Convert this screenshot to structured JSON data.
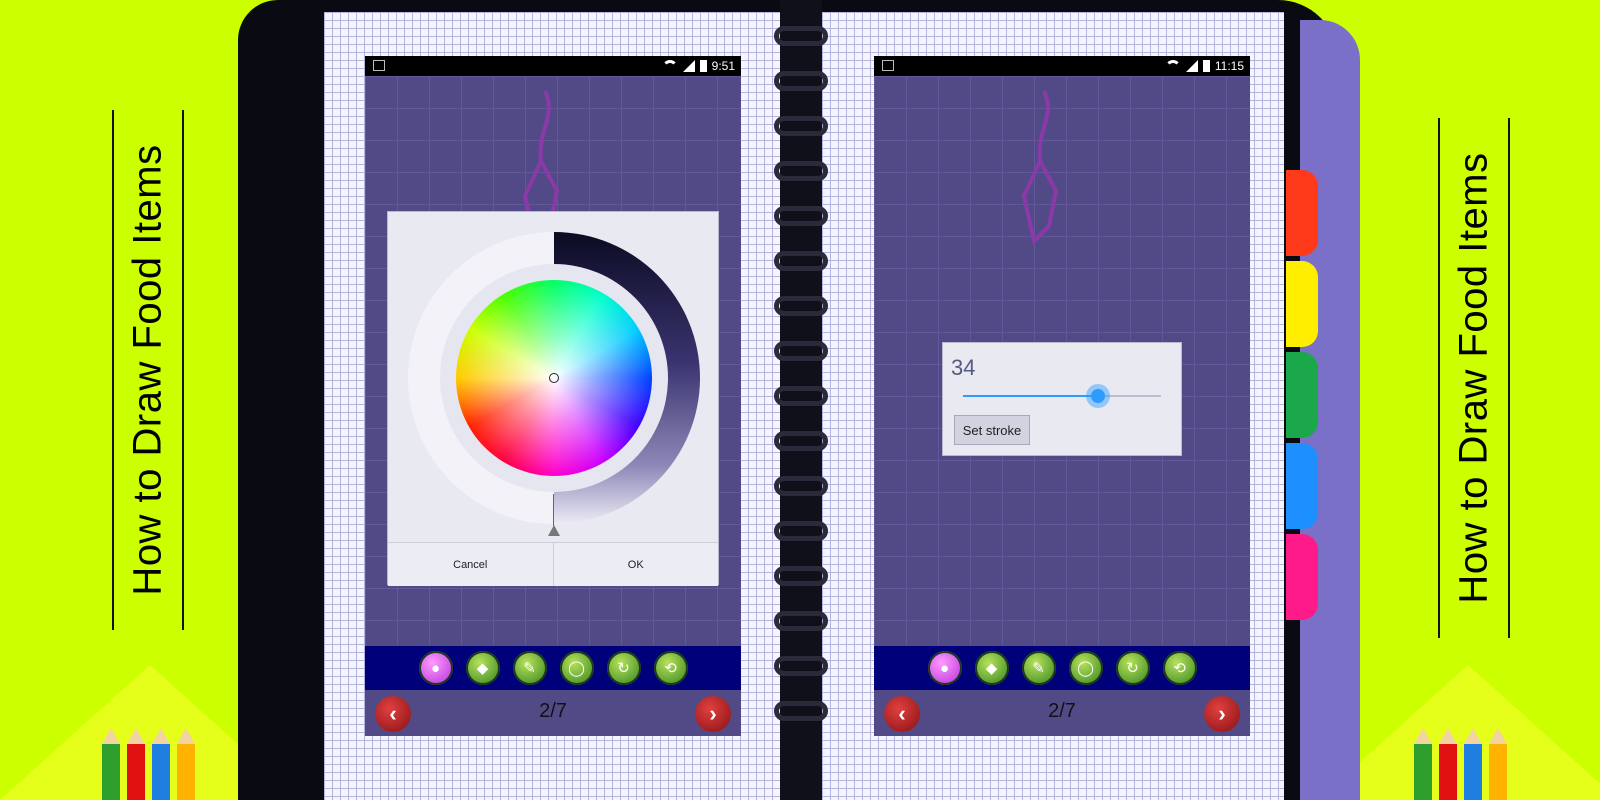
{
  "banner": {
    "title": "How to Draw Food Items"
  },
  "pencil_colors": [
    "#2e9e2e",
    "#e01010",
    "#1e7fe0",
    "#ffb300"
  ],
  "tab_colors": [
    "#ff3a1a",
    "#ffee00",
    "#1aa84a",
    "#1e8fff",
    "#ff1a8a"
  ],
  "screen_left": {
    "status_time": "9:51",
    "color_picker": {
      "cancel_label": "Cancel",
      "ok_label": "OK"
    },
    "page_indicator": "2/7"
  },
  "screen_right": {
    "status_time": "11:15",
    "stroke_dialog": {
      "value": "34",
      "value_fraction": 0.68,
      "button_label": "Set stroke"
    },
    "page_indicator": "2/7"
  },
  "toolbar": {
    "tools": [
      {
        "name": "color-palette-icon",
        "glyph": "●"
      },
      {
        "name": "fill-bucket-icon",
        "glyph": "◆"
      },
      {
        "name": "eraser-icon",
        "glyph": "✎"
      },
      {
        "name": "brush-size-icon",
        "glyph": "◯"
      },
      {
        "name": "redo-icon",
        "glyph": "↻"
      },
      {
        "name": "clear-icon",
        "glyph": "⟲"
      }
    ]
  },
  "nav": {
    "prev_glyph": "‹",
    "next_glyph": "›"
  }
}
